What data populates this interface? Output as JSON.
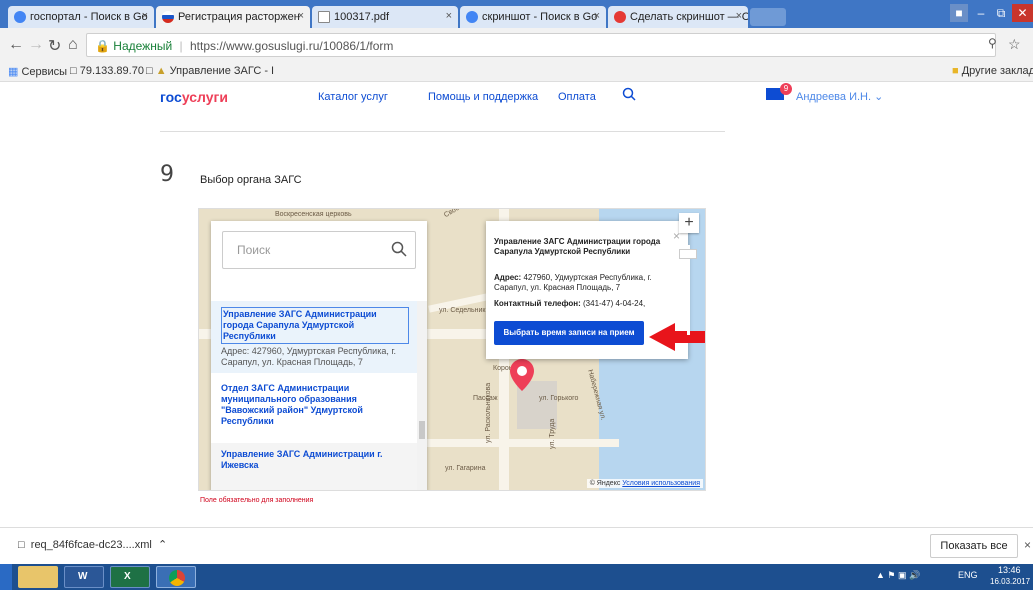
{
  "browser": {
    "tabs": [
      {
        "label": "госпортал - Поиск в Go",
        "close": "×"
      },
      {
        "label": "Регистрация расторжен",
        "close": "×"
      },
      {
        "label": "100317.pdf",
        "close": "×"
      },
      {
        "label": "скриншот - Поиск в Go",
        "close": "×"
      },
      {
        "label": "Сделать скриншот — Ск",
        "close": "×"
      }
    ],
    "secure_label": "Надежный",
    "url": "https://www.gosuslugi.ru/10086/1/form",
    "bookmarks": [
      "Сервисы",
      "79.133.89.70",
      "Управление ЗАГС - I",
      "Другие закладки"
    ]
  },
  "site": {
    "logo_part1": "гос",
    "logo_part2": "услуги",
    "nav": [
      "Каталог услуг",
      "Помощь и поддержка",
      "Оплата"
    ],
    "user": "Андреева И.Н.",
    "notification_count": "9"
  },
  "form": {
    "step_number": "9",
    "step_title": "Выбор органа ЗАГС",
    "search_placeholder": "Поиск",
    "required_note": "Поле обязательно для заполнения"
  },
  "list": {
    "items": [
      {
        "name": "Управление ЗАГС Администрации города Сарапула Удмуртской Республики",
        "addr": "Адрес: 427960, Удмуртская Республика, г. Сарапул, ул. Красная Площадь, 7"
      },
      {
        "name": "Отдел ЗАГС Администрации муниципального образования \"Вавожский район\" Удмуртской Республики",
        "addr": ""
      },
      {
        "name": "Управление ЗАГС Администрации г. Ижевска",
        "addr": ""
      }
    ]
  },
  "popup": {
    "title": "Управление ЗАГС Администрации города Сарапула Удмуртской Республики",
    "address_label": "Адрес:",
    "address": "427960, Удмуртская Республика, г. Сарапул, ул. Красная Площадь, 7",
    "phone_label": "Контактный телефон:",
    "phone": "(341-47) 4-04-24,",
    "button": "Выбрать время записи на прием",
    "close": "×"
  },
  "map": {
    "labels": [
      "Воскресенская церковь",
      "ул. Седельник",
      "ул. Горького",
      "ул. Гагарина",
      "ул. Раскольникова",
      "Набережная ул.",
      "Пассаж",
      "Корона",
      "ул. Труда",
      "Свободы"
    ],
    "copyright": "© Яндекс",
    "terms": "Условия использования",
    "zoom_in": "+"
  },
  "downloads": {
    "file": "req_84f6fcae-dc23....xml",
    "show_all": "Показать все"
  },
  "taskbar": {
    "lang": "ENG",
    "time": "13:46",
    "date": "16.03.2017"
  },
  "colors": {
    "brand_blue": "#0d4cd3",
    "brand_red": "#ee3f58",
    "arrow_red": "#e8141b"
  }
}
